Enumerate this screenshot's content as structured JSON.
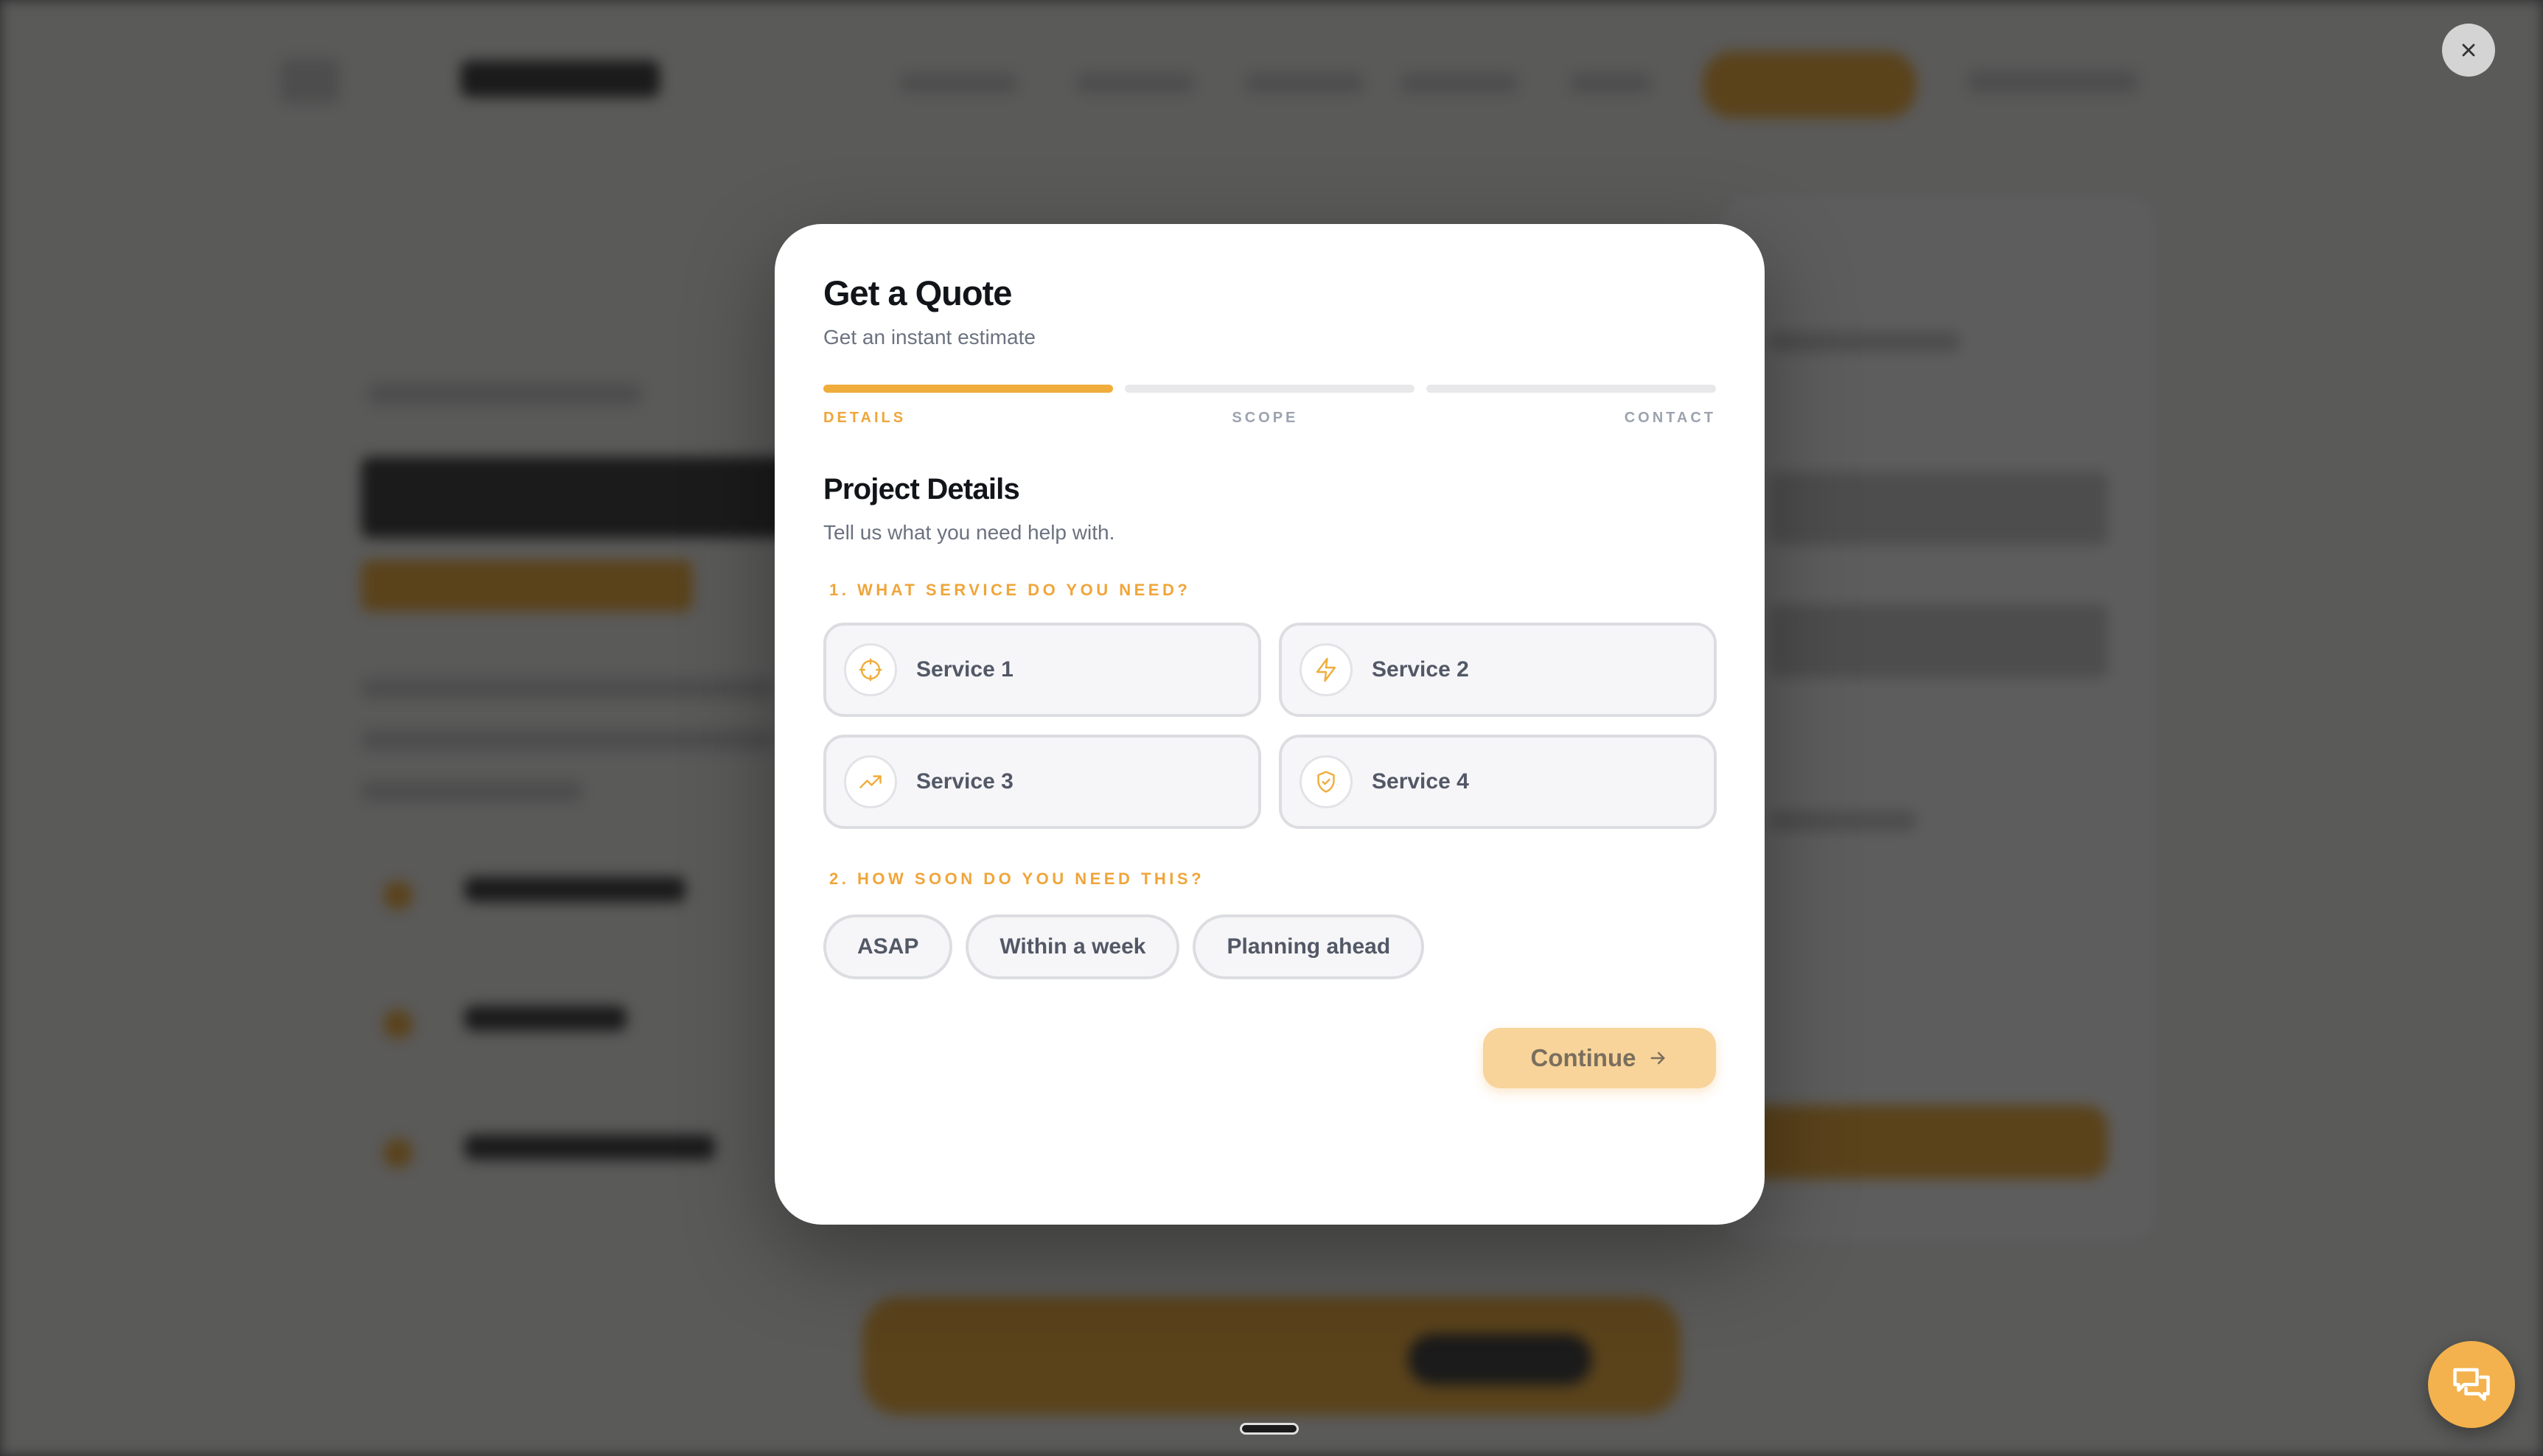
{
  "modal": {
    "title": "Get a Quote",
    "subtitle": "Get an instant estimate",
    "progress": {
      "current_step": 1,
      "total_steps": 3
    },
    "steps": [
      "DETAILS",
      "SCOPE",
      "CONTACT"
    ],
    "section_title": "Project Details",
    "section_description": "Tell us what you need help with.",
    "question_1": "1. WHAT SERVICE DO YOU NEED?",
    "services": [
      {
        "label": "Service 1",
        "icon": "crosshair-icon"
      },
      {
        "label": "Service 2",
        "icon": "lightning-icon"
      },
      {
        "label": "Service 3",
        "icon": "trending-up-icon"
      },
      {
        "label": "Service 4",
        "icon": "shield-check-icon"
      }
    ],
    "question_2": "2. HOW SOON DO YOU NEED THIS?",
    "timeline_options": [
      "ASAP",
      "Within a week",
      "Planning ahead"
    ],
    "continue_label": "Continue"
  },
  "colors": {
    "accent": "#f0ad3c",
    "accent_soft": "#f8d49a",
    "heading": "#111418",
    "muted": "#6b7280"
  },
  "icons": {
    "close": "close-icon",
    "chat": "chat-bubbles-icon",
    "continue": "arrow-right-icon"
  }
}
